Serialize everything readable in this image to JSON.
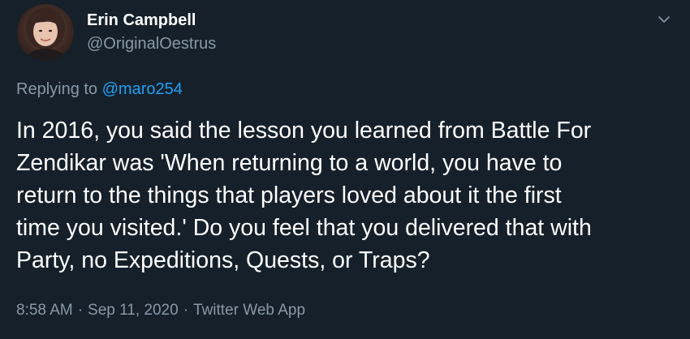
{
  "author": {
    "display_name": "Erin Campbell",
    "handle": "@OriginalOestrus"
  },
  "icons": {
    "menu": "chevron-down-icon",
    "avatar": "profile-photo"
  },
  "reply": {
    "prefix": "Replying to ",
    "mention": "@maro254"
  },
  "tweet": {
    "lines": [
      "In 2016, you said the lesson you learned from Battle For",
      "Zendikar was 'When returning to a world, you have to",
      "return to the things that players loved about it the first",
      "time you visited.' Do you feel that you delivered that with",
      "Party, no Expeditions, Quests, or Traps?"
    ]
  },
  "meta": {
    "time": "8:58 AM",
    "separator": "·",
    "date": "Sep 11, 2020",
    "source": "Twitter Web App"
  },
  "colors": {
    "background": "#15202b",
    "primary_text": "#ffffff",
    "secondary_text": "#8899a6",
    "link": "#1da1f2"
  }
}
